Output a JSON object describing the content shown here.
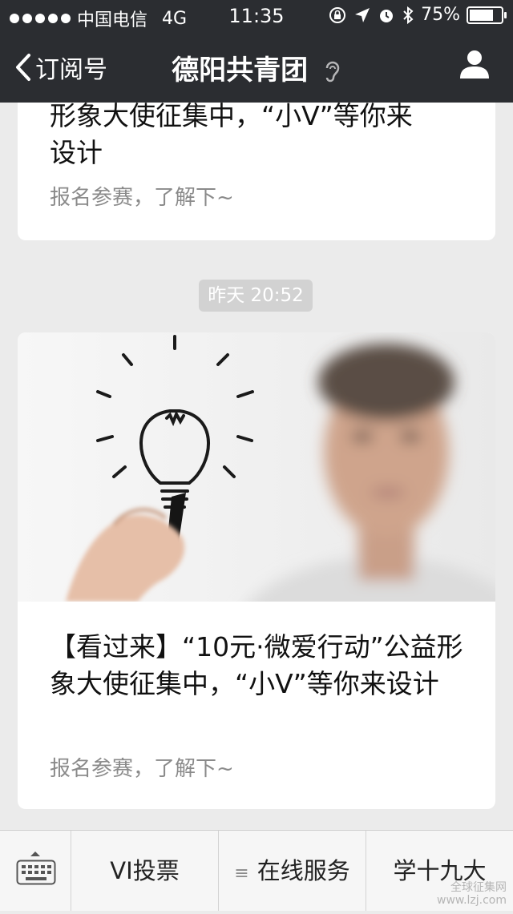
{
  "status_bar": {
    "carrier": "中国电信",
    "network": "4G",
    "time": "11:35",
    "battery": "75%",
    "battery_level": 0.75,
    "icons": [
      "signal-dots-icon",
      "rotation-lock-icon",
      "location-arrow-icon",
      "alarm-icon",
      "bluetooth-icon",
      "battery-icon"
    ]
  },
  "nav": {
    "back_label": "订阅号",
    "title": "德阳共青团",
    "icons": [
      "back-chevron-icon",
      "ear-icon",
      "user-icon"
    ]
  },
  "messages": [
    {
      "title_partial": "形象大使征集中，“小V”等你来\n设计",
      "summary": "报名参赛，了解下~"
    },
    {
      "timestamp": "昨天 20:52",
      "title": "【看过来】“10元·微爱行动”公益形象大使征集中，“小V”等你来设计",
      "summary": "报名参赛，了解下~",
      "image": "lightbulb-drawing-man-image"
    }
  ],
  "menu": {
    "keyboard_icon": "keyboard-icon",
    "items": [
      {
        "label": "VI投票"
      },
      {
        "label": "在线服务",
        "icon": "submenu-lines-icon"
      },
      {
        "label": "学十九大"
      }
    ]
  },
  "watermark": {
    "line1": "全球征集网",
    "line2": "www.lzj.com"
  },
  "colors": {
    "header_bg": "#2b2d31",
    "page_bg": "#ebebeb",
    "card_bg": "#ffffff",
    "summary_text": "#8a8a8a",
    "timestamp_bg": "#d2d2d2"
  }
}
